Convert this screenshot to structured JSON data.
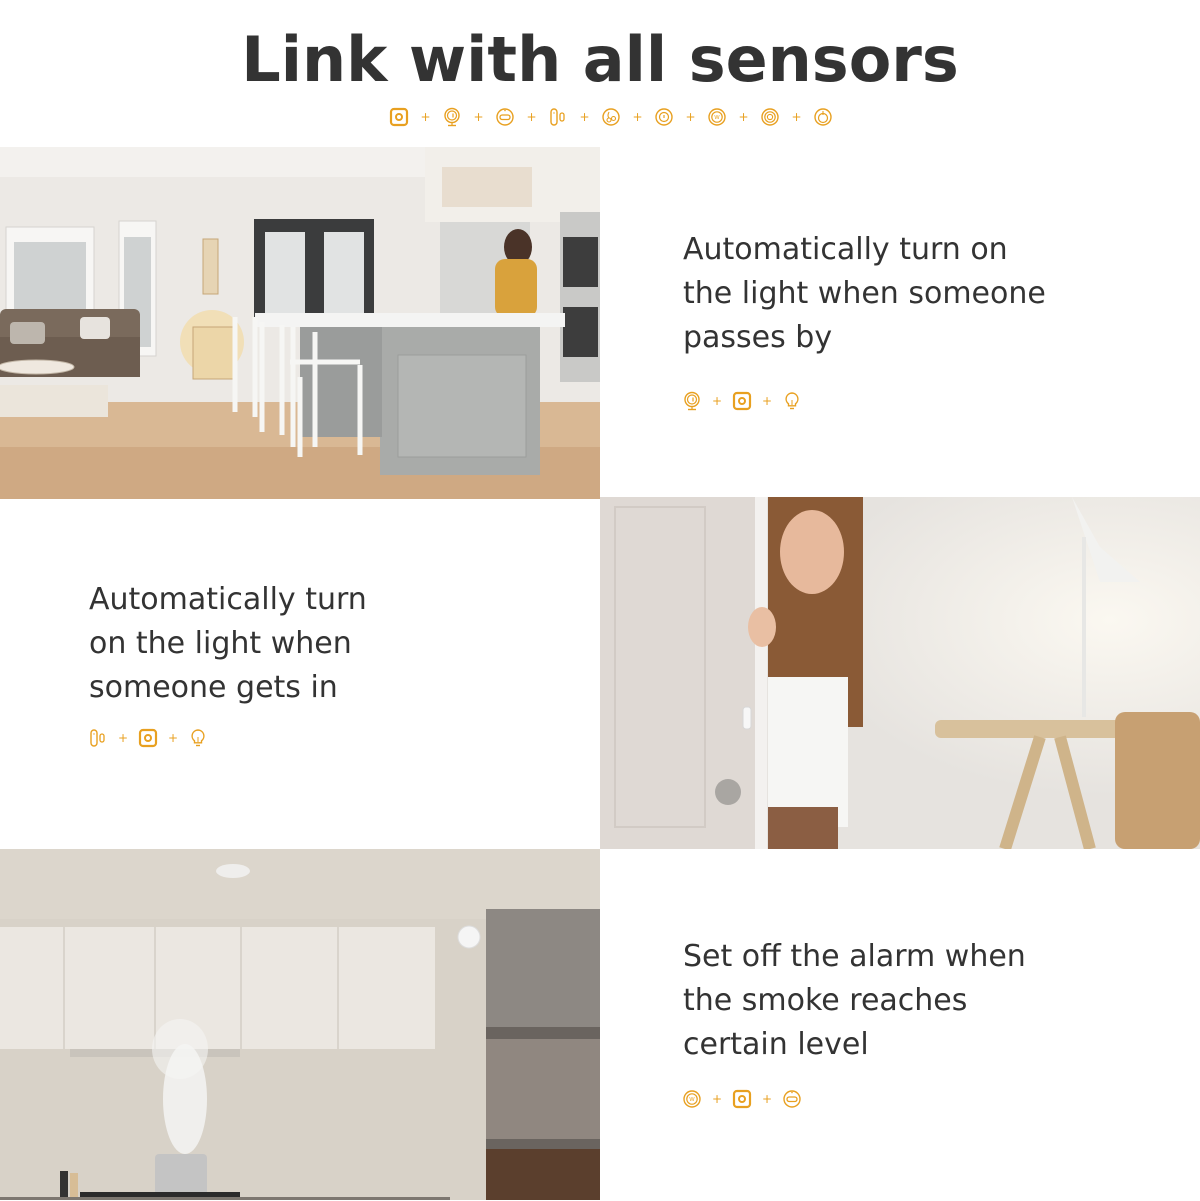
{
  "header": {
    "title": "Link with all sensors",
    "sensor_icons": [
      "hub-icon",
      "motion-sensor-icon",
      "smoke-detector-icon",
      "door-window-sensor-icon",
      "water-leak-sensor-icon",
      "siren-icon",
      "temperature-sensor-icon",
      "button-icon",
      "gas-detector-icon"
    ]
  },
  "accent_color": "#E8A020",
  "panels": [
    {
      "caption": [
        "Automatically turn on",
        "the light when someone",
        "passes by"
      ],
      "icons": [
        "motion-sensor-icon",
        "hub-icon",
        "light-bulb-icon"
      ],
      "photo": "living-room-kitchen-photo"
    },
    {
      "caption": [
        "Automatically turn",
        "on the light when",
        "someone gets in"
      ],
      "icons": [
        "door-window-sensor-icon",
        "hub-icon",
        "light-bulb-icon"
      ],
      "photo": "woman-at-door-photo"
    },
    {
      "caption": [
        "Set off the alarm when",
        "the smoke reaches",
        "certain level"
      ],
      "icons": [
        "smoke-detector-icon",
        "hub-icon",
        "siren-icon"
      ],
      "photo": "kitchen-smoke-photo"
    }
  ],
  "plus_sign": "+"
}
